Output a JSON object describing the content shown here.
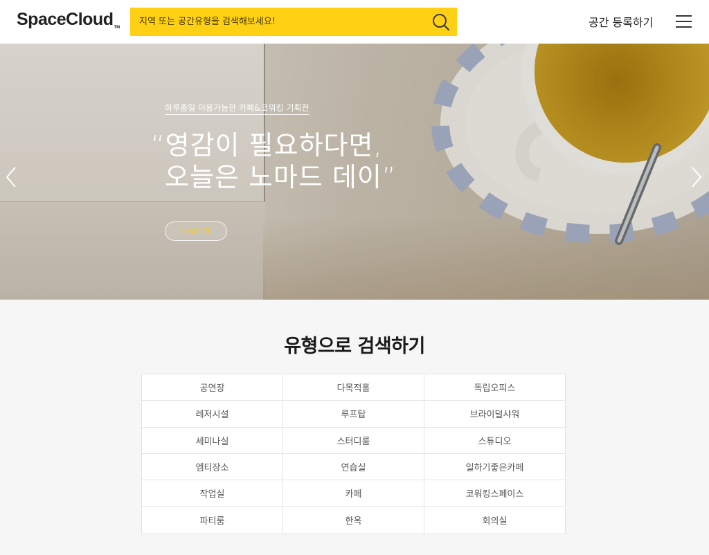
{
  "header": {
    "logo_text": "SpaceCloud",
    "logo_tm": "TM",
    "search_placeholder": "지역 또는 공간유형을 검색해보세요!",
    "register_label": "공간 등록하기"
  },
  "hero": {
    "caption": "하루종일 이용가능한 카페&코워킹 기획전",
    "title_line1": "“영감이 필요하다면,",
    "title_line2": "오늘은 노마드 데이”",
    "button_label": "바로가기"
  },
  "section": {
    "title": "유형으로 검색하기",
    "types": [
      "공연장",
      "다목적홀",
      "독립오피스",
      "레저시설",
      "루프탑",
      "브라이덜샤워",
      "세미나실",
      "스터디룸",
      "스튜디오",
      "엠티장소",
      "연습실",
      "일하기좋은카페",
      "작업실",
      "카페",
      "코워킹스페이스",
      "파티룸",
      "한옥",
      "회의실"
    ]
  },
  "colors": {
    "accent": "#ffd014",
    "header_bg": "#ffffff",
    "page_bg": "#f6f6f6"
  },
  "icons": {
    "search": "search-icon",
    "menu": "hamburger-menu-icon",
    "prev": "chevron-left-icon",
    "next": "chevron-right-icon"
  }
}
